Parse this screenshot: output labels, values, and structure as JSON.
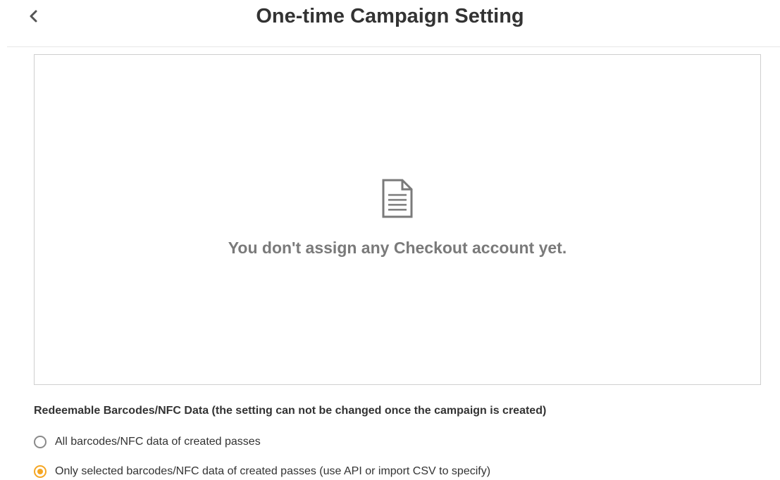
{
  "header": {
    "title": "One-time Campaign Setting",
    "back_icon": "chevron-left-icon"
  },
  "empty_state": {
    "icon": "document-icon",
    "message": "You don't assign any Checkout account yet."
  },
  "redeemable": {
    "label": "Redeemable Barcodes/NFC Data (the setting can not be changed once the campaign is created)",
    "options": [
      {
        "label": "All barcodes/NFC data of created passes",
        "selected": false
      },
      {
        "label": "Only selected barcodes/NFC data of created passes (use API or import CSV to specify)",
        "selected": true
      }
    ]
  },
  "colors": {
    "accent": "#f5a623",
    "text": "#333333",
    "muted": "#7a7a7a",
    "border": "#cfcfcf"
  }
}
